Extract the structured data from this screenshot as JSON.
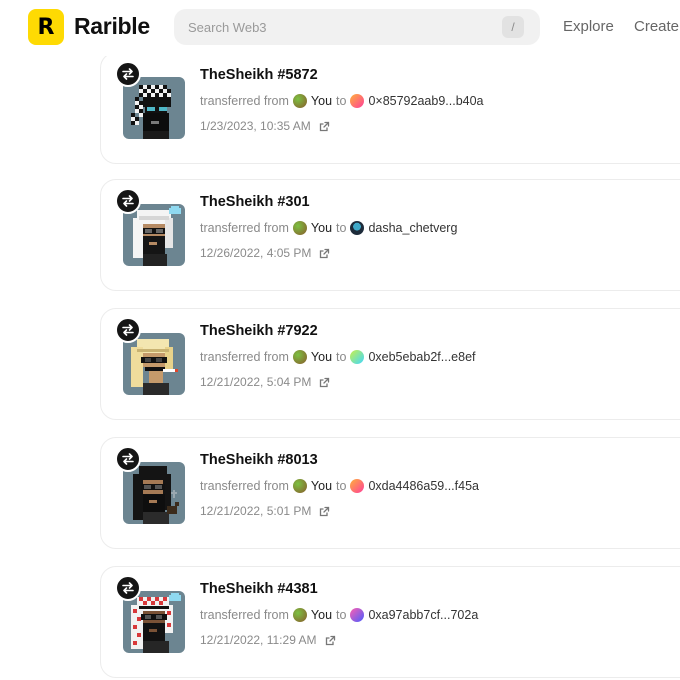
{
  "header": {
    "logo_mark": "R",
    "brand": "Rarible",
    "search_placeholder": "Search Web3",
    "search_shortcut": "/",
    "nav": {
      "explore": "Explore",
      "create": "Create"
    }
  },
  "colors": {
    "brand_yellow": "#FEDA03",
    "badge_dark": "#151515",
    "thumb_bg": "#6c8591"
  },
  "activity": [
    {
      "title": "TheSheikh #5872",
      "action": "transferred from",
      "from": "You",
      "connector": "to",
      "to": "0×85792aab9...b40a",
      "to_avatar": "gradient-orange-pink",
      "date": "1/23/2023, 10:35 AM",
      "headwear": "checkered-keffiyeh"
    },
    {
      "title": "TheSheikh #301",
      "action": "transferred from",
      "from": "You",
      "connector": "to",
      "to": "dasha_chetverg",
      "to_avatar": "profile-photo",
      "date": "12/26/2022, 4:05 PM",
      "headwear": "white-keffiyeh"
    },
    {
      "title": "TheSheikh #7922",
      "action": "transferred from",
      "from": "You",
      "connector": "to",
      "to": "0xeb5ebab2f...e8ef",
      "to_avatar": "gradient-green-blue",
      "date": "12/21/2022, 5:04 PM",
      "headwear": "cream-keffiyeh"
    },
    {
      "title": "TheSheikh #8013",
      "action": "transferred from",
      "from": "You",
      "connector": "to",
      "to": "0xda4486a59...f45a",
      "to_avatar": "gradient-orange-pink",
      "date": "12/21/2022, 5:01 PM",
      "headwear": "long-black-hair"
    },
    {
      "title": "TheSheikh #4381",
      "action": "transferred from",
      "from": "You",
      "connector": "to",
      "to": "0xa97abb7cf...702a",
      "to_avatar": "gradient-pink-blue",
      "date": "12/21/2022, 11:29 AM",
      "headwear": "red-checkered-keffiyeh"
    }
  ]
}
